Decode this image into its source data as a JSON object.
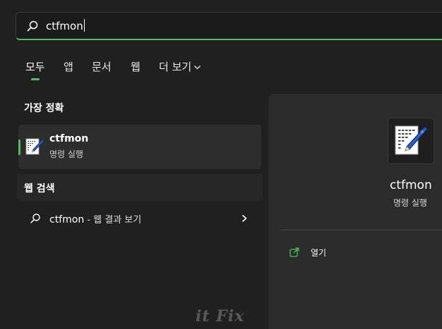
{
  "search": {
    "query": "ctfmon"
  },
  "tabs": [
    {
      "label": "모두",
      "active": true
    },
    {
      "label": "앱"
    },
    {
      "label": "문서"
    },
    {
      "label": "웹"
    },
    {
      "label": "더 보기"
    }
  ],
  "best_match": {
    "section_title": "가장 정확",
    "name": "ctfmon",
    "type": "명령 실행",
    "icon": "ctfmon-app-icon"
  },
  "web_search": {
    "section_title": "웹 검색",
    "query": "ctfmon",
    "suffix": " - 웹 결과 보기"
  },
  "preview": {
    "name": "ctfmon",
    "type": "명령 실행",
    "actions": [
      {
        "label": "열기",
        "icon": "open-icon"
      }
    ]
  },
  "watermark": "it Fix",
  "colors": {
    "accent": "#4cc15a",
    "background": "#202020",
    "panel": "#2b2b2b"
  }
}
